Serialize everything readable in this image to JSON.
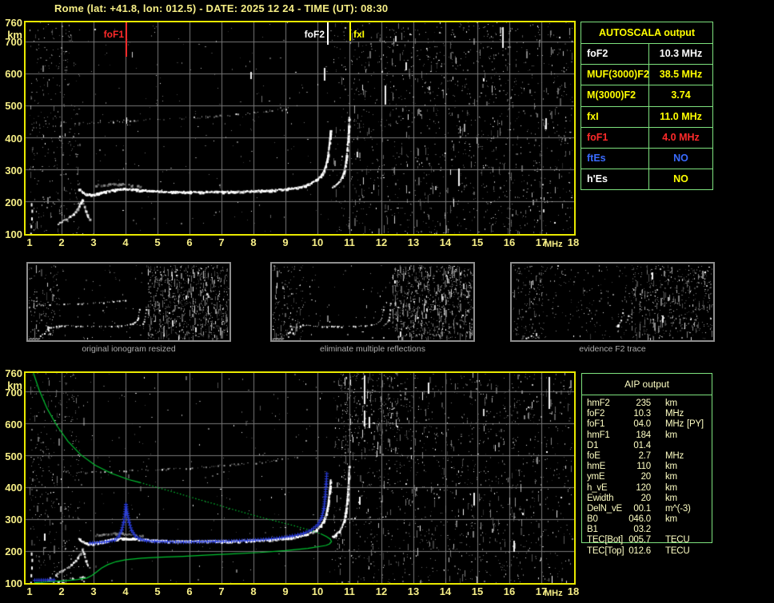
{
  "title": "Rome (lat: +41.8, lon: 012.5) - DATE: 2025 12 24 - TIME (UT): 08:30",
  "colors": {
    "background": "#000000",
    "title_yellow": "#F6EE86",
    "plot_border_yellow": "#E9E900",
    "grid_gray": "#787878",
    "table_border_green": "#7EE27E",
    "bright_yellow": "#FFFF00",
    "red": "#FF2A2A",
    "blue": "#3A6BFF",
    "profile_green": "#00C431",
    "restored_trace_blue": "#2B3FE0",
    "aip_text": "#FFFFC4",
    "caption_gray": "#ABABAB"
  },
  "autoscala_table": {
    "title": "AUTOSCALA output",
    "rows": [
      {
        "param": "foF2",
        "value": "10.3 MHz",
        "label_color": "white",
        "value_color": "white"
      },
      {
        "param": "MUF(3000)F2",
        "value": "38.5 MHz",
        "label_color": "yellow",
        "value_color": "yellow"
      },
      {
        "param": "M(3000)F2",
        "value": "3.74",
        "label_color": "yellow",
        "value_color": "yellow"
      },
      {
        "param": "fxI",
        "value": "11.0 MHz",
        "label_color": "yellow",
        "value_color": "yellow"
      },
      {
        "param": "foF1",
        "value": "4.0 MHz",
        "label_color": "red",
        "value_color": "red"
      },
      {
        "param": "ftEs",
        "value": "NO",
        "label_color": "blue",
        "value_color": "blue"
      },
      {
        "param": "h'Es",
        "value": "NO",
        "label_color": "white",
        "value_color": "yellow"
      }
    ]
  },
  "thumbnails": [
    {
      "caption": "original ionogram resized"
    },
    {
      "caption": "eliminate multiple reflections"
    },
    {
      "caption": "evidence F2 trace"
    }
  ],
  "aip_table": {
    "title": "AIP output",
    "rows": [
      {
        "param": "hmF2",
        "value": "235",
        "unit": "km",
        "note": ""
      },
      {
        "param": "foF2",
        "value": "10.3",
        "unit": "MHz",
        "note": ""
      },
      {
        "param": "foF1",
        "value": "04.0",
        "unit": "MHz",
        "note": "[PY]"
      },
      {
        "param": "hmF1",
        "value": "184",
        "unit": "km",
        "note": ""
      },
      {
        "param": "D1",
        "value": "01.4",
        "unit": "",
        "note": ""
      },
      {
        "param": "foE",
        "value": "2.7",
        "unit": "MHz",
        "note": ""
      },
      {
        "param": "hmE",
        "value": "110",
        "unit": "km",
        "note": ""
      },
      {
        "param": "ymE",
        "value": "20",
        "unit": "km",
        "note": ""
      },
      {
        "param": "h_vE",
        "value": "120",
        "unit": "km",
        "note": ""
      },
      {
        "param": "Ewidth",
        "value": "20",
        "unit": "km",
        "note": ""
      },
      {
        "param": "DelN_vE",
        "value": "00.1",
        "unit": "m^(-3)",
        "note": ""
      },
      {
        "param": "B0",
        "value": "046.0",
        "unit": "km",
        "note": ""
      },
      {
        "param": "B1",
        "value": "03.2",
        "unit": "",
        "note": ""
      },
      {
        "param": "TEC[Bot]",
        "value": "005.7",
        "unit": "TECU",
        "note": ""
      },
      {
        "param": "TEC[Top]",
        "value": "012.6",
        "unit": "TECU",
        "note": ""
      }
    ]
  },
  "chart_data": [
    {
      "type": "scatter",
      "x_unit": "MHz",
      "y_unit": "km",
      "xlim": [
        1,
        18
      ],
      "ylim": [
        100,
        760
      ],
      "grid": true,
      "point_format": "[frequency_MHz, virtual_height_km]",
      "xticks": [
        1,
        2,
        3,
        4,
        5,
        6,
        7,
        8,
        9,
        10,
        11,
        12,
        13,
        14,
        15,
        16,
        17,
        18
      ],
      "yticks": [
        760,
        700,
        600,
        500,
        400,
        300,
        200,
        100
      ],
      "markers": [
        {
          "label": "foF1",
          "frequency_mhz": 4.0,
          "color": "red"
        },
        {
          "label": "foF2",
          "frequency_mhz": 10.3,
          "color": "white"
        },
        {
          "label": "fxI",
          "frequency_mhz": 11.0,
          "color": "yellow"
        }
      ],
      "traces": {
        "second_hop": [
          [
            2.05,
            452
          ],
          [
            2.4,
            448
          ],
          [
            2.8,
            448
          ],
          [
            3.2,
            450
          ],
          [
            3.6,
            452
          ],
          [
            4.0,
            454
          ],
          [
            4.5,
            456
          ],
          [
            5.0,
            458
          ],
          [
            5.5,
            460
          ],
          [
            6.0,
            463
          ],
          [
            6.5,
            466
          ],
          [
            7.0,
            470
          ],
          [
            7.5,
            474
          ],
          [
            8.0,
            479
          ],
          [
            8.5,
            485
          ],
          [
            9.0,
            492
          ],
          [
            9.35,
            499
          ]
        ],
        "e_cusp": [
          [
            1.8,
            128
          ],
          [
            2.0,
            141
          ],
          [
            2.2,
            154
          ],
          [
            2.35,
            165
          ],
          [
            2.48,
            180
          ],
          [
            2.58,
            198
          ],
          [
            2.63,
            208
          ],
          [
            2.68,
            193
          ],
          [
            2.74,
            172
          ],
          [
            2.8,
            157
          ],
          [
            2.86,
            149
          ]
        ],
        "f_trace": [
          [
            2.52,
            242
          ],
          [
            2.62,
            233
          ],
          [
            2.75,
            226
          ],
          [
            2.9,
            224
          ],
          [
            3.1,
            228
          ],
          [
            3.35,
            234
          ],
          [
            3.6,
            239
          ],
          [
            3.9,
            242
          ],
          [
            4.2,
            241
          ],
          [
            4.5,
            238
          ],
          [
            4.8,
            236
          ],
          [
            5.2,
            234
          ],
          [
            5.6,
            233
          ],
          [
            6.0,
            233
          ],
          [
            6.5,
            233
          ],
          [
            7.0,
            233
          ],
          [
            7.5,
            234
          ],
          [
            8.0,
            236
          ],
          [
            8.5,
            238
          ],
          [
            9.0,
            242
          ],
          [
            9.35,
            247
          ],
          [
            9.6,
            253
          ],
          [
            9.8,
            261
          ],
          [
            9.95,
            270
          ],
          [
            10.08,
            282
          ],
          [
            10.18,
            298
          ],
          [
            10.25,
            318
          ],
          [
            10.3,
            342
          ],
          [
            10.34,
            372
          ],
          [
            10.37,
            402
          ],
          [
            10.39,
            425
          ]
        ],
        "x_branch": [
          [
            10.42,
            246
          ],
          [
            10.55,
            254
          ],
          [
            10.66,
            264
          ],
          [
            10.75,
            279
          ],
          [
            10.82,
            300
          ],
          [
            10.87,
            328
          ],
          [
            10.91,
            362
          ],
          [
            10.94,
            400
          ],
          [
            10.96,
            440
          ],
          [
            10.97,
            468
          ]
        ],
        "gray_band": [
          [
            3.05,
            252
          ],
          [
            3.3,
            256
          ],
          [
            3.6,
            258
          ],
          [
            3.9,
            257
          ],
          [
            4.2,
            254
          ],
          [
            4.5,
            250
          ]
        ],
        "left_marks": [
          [
            1.02,
            104
          ],
          [
            1.03,
            128
          ],
          [
            1.05,
            152
          ],
          [
            1.06,
            176
          ],
          [
            1.04,
            196
          ]
        ]
      },
      "f2_evidence_fragments": {
        "left_arc": [
          [
            1.65,
            100
          ],
          [
            2.0,
            112
          ],
          [
            2.35,
            128
          ],
          [
            2.6,
            146
          ],
          [
            2.8,
            166
          ],
          [
            2.92,
            186
          ]
        ],
        "o_branch": [
          [
            9.8,
            238
          ],
          [
            9.95,
            252
          ],
          [
            10.08,
            272
          ],
          [
            10.18,
            298
          ],
          [
            10.26,
            330
          ],
          [
            10.32,
            368
          ],
          [
            10.36,
            400
          ]
        ],
        "x_branch": [
          [
            10.5,
            252
          ],
          [
            10.62,
            272
          ],
          [
            10.72,
            300
          ],
          [
            10.8,
            338
          ],
          [
            10.85,
            375
          ]
        ]
      }
    },
    {
      "type": "scatter",
      "x_unit": "MHz",
      "y_unit": "km",
      "xlim": [
        1,
        18
      ],
      "ylim": [
        100,
        760
      ],
      "grid": true,
      "point_format": "[frequency_MHz, height_km]",
      "xticks": [
        1,
        2,
        3,
        4,
        5,
        6,
        7,
        8,
        9,
        10,
        11,
        12,
        13,
        14,
        15,
        16,
        17,
        18
      ],
      "yticks": [
        760,
        700,
        600,
        500,
        400,
        300,
        200,
        100
      ],
      "restored_trace": {
        "color": "blue",
        "e_layer": [
          [
            1.15,
            110
          ],
          [
            1.75,
            111
          ]
        ],
        "f_layer": [
          [
            2.88,
            227
          ],
          [
            3.1,
            228
          ],
          [
            3.4,
            231
          ],
          [
            3.65,
            236
          ],
          [
            3.78,
            248
          ],
          [
            3.87,
            268
          ],
          [
            3.93,
            292
          ],
          [
            3.97,
            318
          ],
          [
            4.0,
            348
          ],
          [
            4.04,
            320
          ],
          [
            4.1,
            292
          ],
          [
            4.18,
            266
          ],
          [
            4.3,
            248
          ],
          [
            4.45,
            239
          ],
          [
            4.65,
            234
          ],
          [
            4.9,
            232
          ],
          [
            5.3,
            231
          ],
          [
            5.8,
            230
          ],
          [
            6.3,
            231
          ],
          [
            6.8,
            232
          ],
          [
            7.3,
            233
          ],
          [
            7.8,
            235
          ],
          [
            8.3,
            238
          ],
          [
            8.8,
            243
          ],
          [
            9.2,
            249
          ],
          [
            9.55,
            257
          ],
          [
            9.8,
            268
          ],
          [
            10.0,
            284
          ],
          [
            10.12,
            306
          ],
          [
            10.19,
            335
          ],
          [
            10.23,
            372
          ],
          [
            10.26,
            412
          ],
          [
            10.28,
            445
          ]
        ]
      },
      "electron_density_profile": {
        "color": "green",
        "topside_solid": [
          [
            1.12,
            760
          ],
          [
            1.3,
            706
          ],
          [
            1.55,
            648
          ],
          [
            1.85,
            595
          ],
          [
            2.2,
            545
          ],
          [
            2.6,
            503
          ],
          [
            3.05,
            470
          ],
          [
            3.55,
            445
          ],
          [
            4.1,
            425
          ],
          [
            4.45,
            416
          ]
        ],
        "topside_dotted": [
          [
            4.45,
            416
          ],
          [
            5.0,
            400
          ],
          [
            5.6,
            383
          ],
          [
            6.2,
            365
          ],
          [
            6.8,
            348
          ],
          [
            7.4,
            330
          ],
          [
            8.0,
            313
          ],
          [
            8.6,
            297
          ],
          [
            9.2,
            282
          ],
          [
            9.7,
            268
          ],
          [
            10.1,
            255
          ]
        ],
        "peak_loop": [
          [
            10.1,
            255
          ],
          [
            10.28,
            246
          ],
          [
            10.4,
            238
          ],
          [
            10.44,
            230
          ],
          [
            10.38,
            223
          ],
          [
            10.26,
            218
          ]
        ],
        "bottomside": [
          [
            10.26,
            218
          ],
          [
            9.7,
            209
          ],
          [
            9.0,
            202
          ],
          [
            8.2,
            196
          ],
          [
            7.4,
            192
          ],
          [
            6.6,
            188
          ],
          [
            5.8,
            184
          ],
          [
            5.1,
            181
          ],
          [
            4.5,
            178
          ],
          [
            4.0,
            173
          ],
          [
            3.7,
            167
          ],
          [
            3.45,
            158
          ],
          [
            3.25,
            147
          ],
          [
            3.1,
            135
          ],
          [
            2.95,
            124
          ],
          [
            2.8,
            116
          ],
          [
            2.5,
            111
          ],
          [
            2.1,
            107
          ],
          [
            1.6,
            104
          ],
          [
            1.15,
            101
          ]
        ]
      }
    }
  ]
}
